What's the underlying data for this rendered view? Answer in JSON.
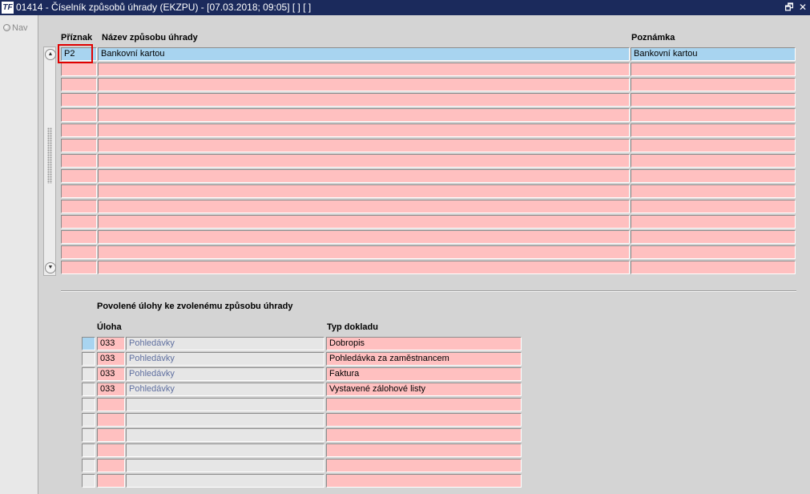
{
  "window": {
    "title": "01414 - Číselník způsobů úhrady (EKZPU) - [07.03.2018; 09:05]  [ ]  [ ]",
    "logo_text": "TF",
    "restore_glyph": "🗗",
    "close_glyph": "✕"
  },
  "nav": {
    "label": "Nav"
  },
  "main_grid": {
    "headers": {
      "priznak": "Příznak",
      "nazev": "Název způsobu úhrady",
      "poznamka": "Poznámka"
    },
    "rows": [
      {
        "priznak": "P2",
        "nazev": "Bankovní kartou",
        "poznamka": "Bankovní kartou"
      },
      {
        "priznak": "",
        "nazev": "",
        "poznamka": ""
      },
      {
        "priznak": "",
        "nazev": "",
        "poznamka": ""
      },
      {
        "priznak": "",
        "nazev": "",
        "poznamka": ""
      },
      {
        "priznak": "",
        "nazev": "",
        "poznamka": ""
      },
      {
        "priznak": "",
        "nazev": "",
        "poznamka": ""
      },
      {
        "priznak": "",
        "nazev": "",
        "poznamka": ""
      },
      {
        "priznak": "",
        "nazev": "",
        "poznamka": ""
      },
      {
        "priznak": "",
        "nazev": "",
        "poznamka": ""
      },
      {
        "priznak": "",
        "nazev": "",
        "poznamka": ""
      },
      {
        "priznak": "",
        "nazev": "",
        "poznamka": ""
      },
      {
        "priznak": "",
        "nazev": "",
        "poznamka": ""
      },
      {
        "priznak": "",
        "nazev": "",
        "poznamka": ""
      },
      {
        "priznak": "",
        "nazev": "",
        "poznamka": ""
      },
      {
        "priznak": "",
        "nazev": "",
        "poznamka": ""
      }
    ]
  },
  "scrollbar": {
    "up_glyph": "▲",
    "down_glyph": "▼"
  },
  "detail": {
    "section_title": "Povolené úlohy ke zvolenému způsobu úhrady",
    "headers": {
      "uloha": "Úloha",
      "typ_dokladu": "Typ dokladu"
    },
    "rows": [
      {
        "kod": "033",
        "uloha": "Pohledávky",
        "typ": "Dobropis"
      },
      {
        "kod": "033",
        "uloha": "Pohledávky",
        "typ": "Pohledávka za zaměstnancem"
      },
      {
        "kod": "033",
        "uloha": "Pohledávky",
        "typ": "Faktura"
      },
      {
        "kod": "033",
        "uloha": "Pohledávky",
        "typ": "Vystavené zálohové listy"
      },
      {
        "kod": "",
        "uloha": "",
        "typ": ""
      },
      {
        "kod": "",
        "uloha": "",
        "typ": ""
      },
      {
        "kod": "",
        "uloha": "",
        "typ": ""
      },
      {
        "kod": "",
        "uloha": "",
        "typ": ""
      },
      {
        "kod": "",
        "uloha": "",
        "typ": ""
      },
      {
        "kod": "",
        "uloha": "",
        "typ": ""
      }
    ]
  }
}
